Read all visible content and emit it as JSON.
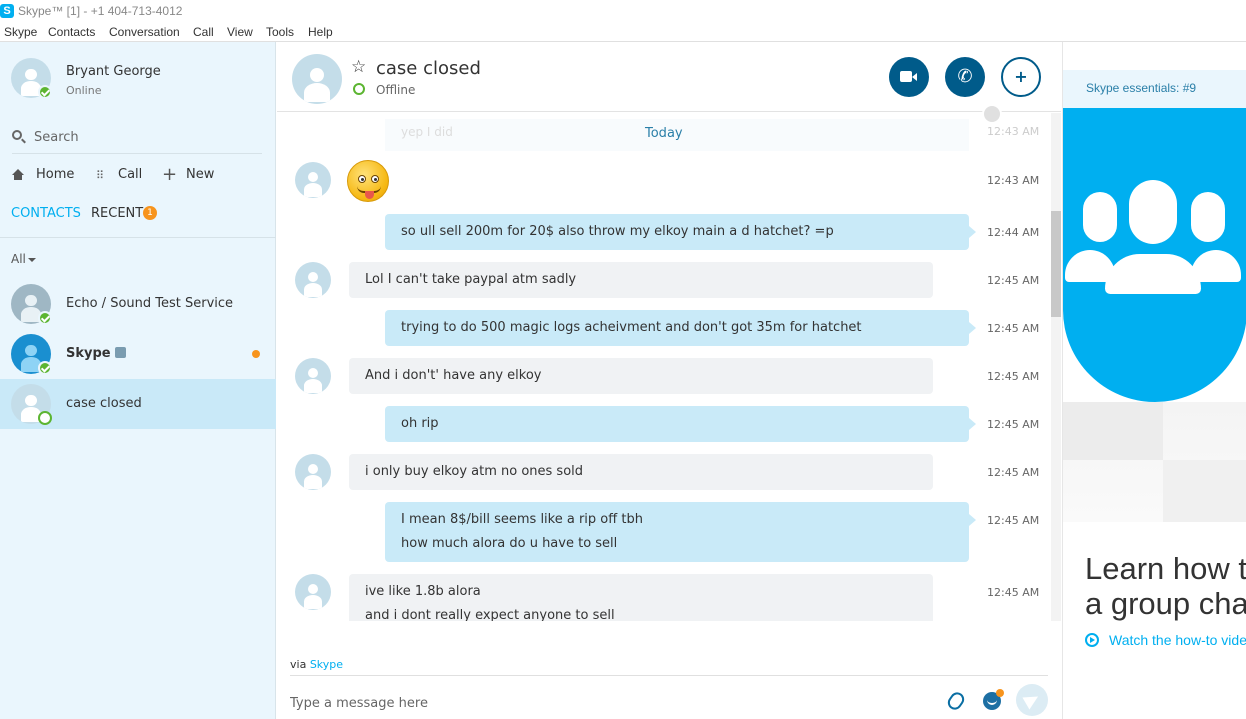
{
  "window": {
    "title": "Skype™ [1] - +1 404-713-4012",
    "logo_letter": "S"
  },
  "menu": [
    "Skype",
    "Contacts",
    "Conversation",
    "Call",
    "View",
    "Tools",
    "Help"
  ],
  "profile": {
    "name": "Bryant George",
    "status": "Online"
  },
  "search": {
    "placeholder": "Search"
  },
  "nav": {
    "home": "Home",
    "call": "Call",
    "new": "New"
  },
  "tabs": {
    "contacts": "CONTACTS",
    "recent": "RECENT",
    "recent_badge": "1"
  },
  "filter": "All",
  "contacts": [
    {
      "name": "Echo / Sound Test Service",
      "status": "online"
    },
    {
      "name": "Skype",
      "status": "online",
      "verified": true,
      "unread": true
    },
    {
      "name": "case closed",
      "status": "offline",
      "selected": true
    }
  ],
  "chat": {
    "title": "case closed",
    "status": "Offline",
    "date_divider": "Today",
    "faded_preview": "yep I did",
    "faded_time": "12:43 AM",
    "messages": [
      {
        "dir": "in",
        "emoji": "tongue-out",
        "time": "12:43 AM"
      },
      {
        "dir": "out",
        "lines": [
          "so ull sell 200m for 20$ also throw my elkoy main a d hatchet? =p"
        ],
        "time": "12:44 AM"
      },
      {
        "dir": "in",
        "lines": [
          "Lol I can't take paypal atm sadly"
        ],
        "time": "12:45 AM"
      },
      {
        "dir": "out",
        "lines": [
          "trying to do 500 magic logs acheivment and don't got 35m for hatchet"
        ],
        "time": "12:45 AM"
      },
      {
        "dir": "in",
        "lines": [
          "And i don't' have any elkoy"
        ],
        "time": "12:45 AM"
      },
      {
        "dir": "out",
        "lines": [
          "oh rip"
        ],
        "time": "12:45 AM"
      },
      {
        "dir": "in",
        "lines": [
          "i only buy elkoy atm no ones sold"
        ],
        "time": "12:45 AM"
      },
      {
        "dir": "out",
        "lines": [
          "I mean 8$/bill seems like a rip off tbh",
          "how much alora do u have to sell"
        ],
        "time": "12:45 AM"
      },
      {
        "dir": "in",
        "lines": [
          "ive like 1.8b alora",
          "and i dont really expect anyone to sell"
        ],
        "time": "12:45 AM"
      }
    ],
    "via_prefix": "via",
    "via_link": "Skype",
    "compose_placeholder": "Type a message here"
  },
  "ad": {
    "title": "Skype essentials: #9",
    "headline_1": "Learn how to",
    "headline_2": "a group cha",
    "link": "Watch the how-to vide"
  },
  "colors": {
    "accent": "#00aff0",
    "button_dark": "#005b8a",
    "online": "#5cb531",
    "badge": "#f7941d"
  }
}
